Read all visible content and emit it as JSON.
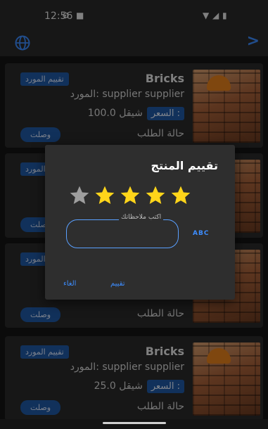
{
  "status_bar": {
    "time": "12:56"
  },
  "cards": [
    {
      "product": "Bricks",
      "supplier": "المورد: supplier supplier",
      "price_label": "السعر :",
      "price_value": "100.0 شيقل",
      "status_label": "حالة الطلب",
      "rate_supplier": "تقييم المورد",
      "arrived": "وصلت"
    },
    {
      "product": "",
      "supplier": "",
      "price_label": "",
      "price_value": "",
      "status_label": "",
      "rate_supplier": "تقييم المورد",
      "arrived": "وصلت"
    },
    {
      "product": "",
      "supplier": "",
      "price_label": "",
      "price_value": "",
      "status_label": "حالة الطلب",
      "rate_supplier": "تقييم المورد",
      "arrived": "وصلت"
    },
    {
      "product": "Bricks",
      "supplier": "المورد: supplier supplier",
      "price_label": "السعر :",
      "price_value": "25.0 شيقل",
      "status_label": "حالة الطلب",
      "rate_supplier": "تقييم المورد",
      "arrived": "وصلت"
    }
  ],
  "dialog": {
    "title": "تقييم المنتج",
    "rating": 4,
    "max_rating": 5,
    "notes_label": "اكتب ملاحظاتك",
    "notes_value": "",
    "keyboard_hint": "ABC",
    "cancel_label": "الغاء",
    "rate_label": "تقييم"
  },
  "colors": {
    "accent": "#3d8dff",
    "star_filled": "#ffd51a",
    "star_empty": "#9e9e9e",
    "button_bg": "#1f5aa6"
  }
}
